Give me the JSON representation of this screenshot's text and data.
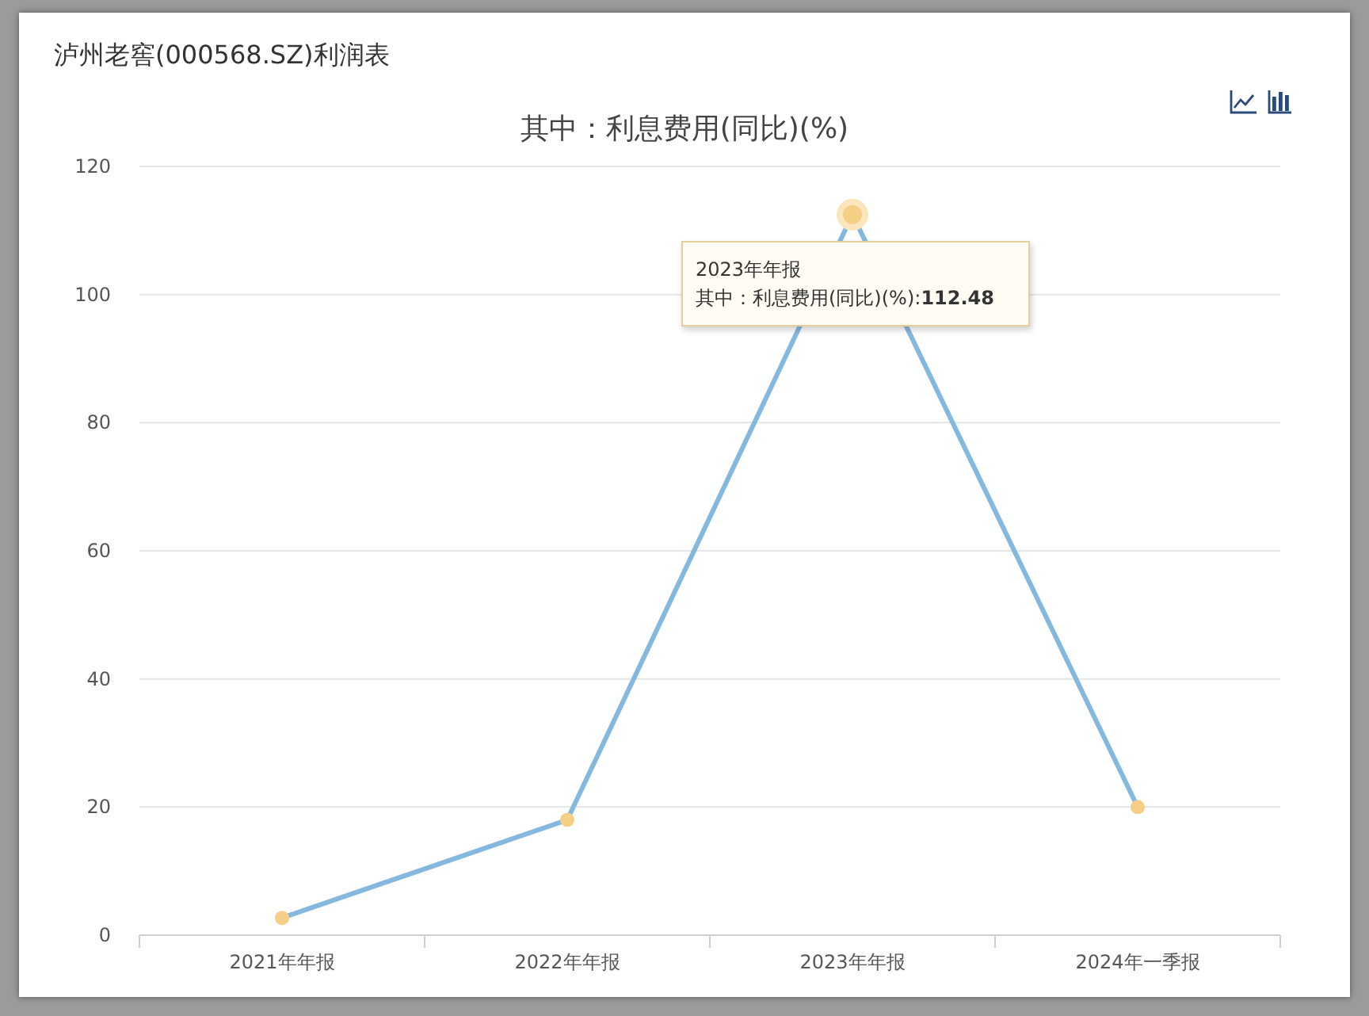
{
  "title": "泸州老窖(000568.SZ)利润表",
  "chart_data": {
    "type": "line",
    "title": "其中：利息费用(同比)(%)",
    "grid": true,
    "categories": [
      "2021年年报",
      "2022年年报",
      "2023年年报",
      "2024年一季报"
    ],
    "series": [
      {
        "name": "其中：利息费用(同比)(%)",
        "color": "#85b8de",
        "marker": "circle",
        "values": [
          2.7,
          18.0,
          112.48,
          20.0
        ]
      }
    ],
    "ylim": [
      0,
      120
    ],
    "yticks": [
      0,
      20,
      40,
      60,
      80,
      100,
      120
    ]
  },
  "points": [
    {
      "selected": false
    },
    {
      "selected": false
    },
    {
      "selected": true
    },
    {
      "selected": false
    }
  ],
  "tooltip": {
    "value": ":**112.48**"
  }
}
